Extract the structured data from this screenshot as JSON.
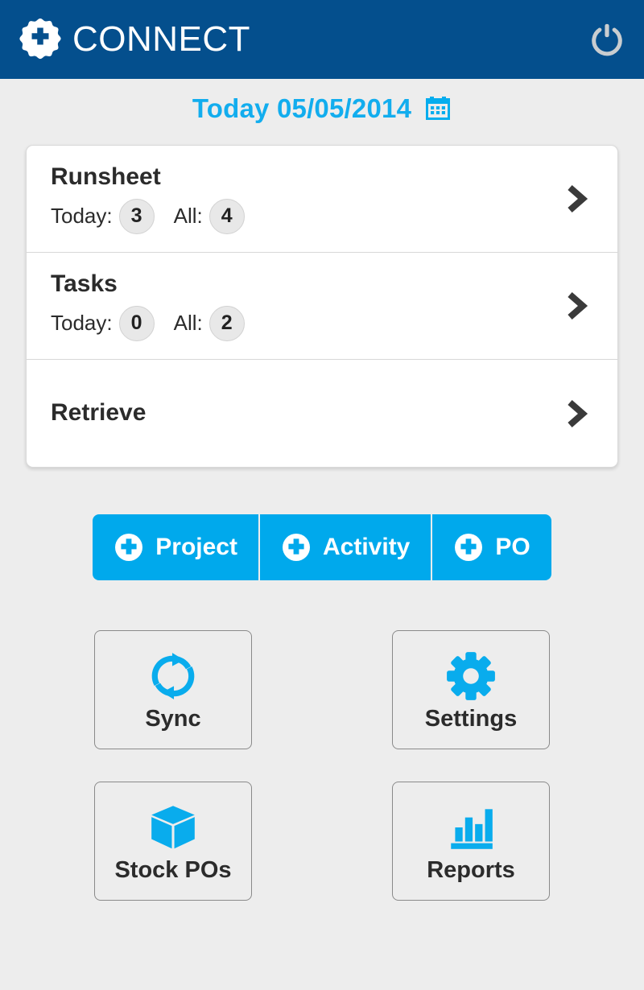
{
  "theme": {
    "header_blue": "#044F8D",
    "accent_blue": "#00A9EC",
    "date_blue": "#12ADEE",
    "page_bg": "#ededed",
    "card_bg": "#ffffff",
    "text_dark": "#2b2b2b",
    "badge_bg": "#e8e8e8"
  },
  "header": {
    "title": "CONNECT",
    "logo_icon": "cog-plus-logo-icon",
    "power_icon": "power-icon"
  },
  "date_bar": {
    "label": "Today 05/05/2014",
    "calendar_icon": "calendar-icon"
  },
  "menu": {
    "rows": [
      {
        "title": "Runsheet",
        "has_counts": true,
        "counts": [
          {
            "label": "Today:",
            "value": "3"
          },
          {
            "label": "All:",
            "value": "4"
          }
        ],
        "chevron_icon": "chevron-right-icon"
      },
      {
        "title": "Tasks",
        "has_counts": true,
        "counts": [
          {
            "label": "Today:",
            "value": "0"
          },
          {
            "label": "All:",
            "value": "2"
          }
        ],
        "chevron_icon": "chevron-right-icon"
      },
      {
        "title": "Retrieve",
        "has_counts": false,
        "counts": [],
        "chevron_icon": "chevron-right-icon"
      }
    ]
  },
  "add_buttons": [
    {
      "label": "Project",
      "icon": "plus-circle-icon"
    },
    {
      "label": "Activity",
      "icon": "plus-circle-icon"
    },
    {
      "label": "PO",
      "icon": "plus-circle-icon"
    }
  ],
  "tiles": [
    {
      "label": "Sync",
      "icon": "sync-refresh-icon"
    },
    {
      "label": "Settings",
      "icon": "gear-icon"
    },
    {
      "label": "Stock POs",
      "icon": "box-cube-icon"
    },
    {
      "label": "Reports",
      "icon": "bar-chart-icon"
    }
  ]
}
